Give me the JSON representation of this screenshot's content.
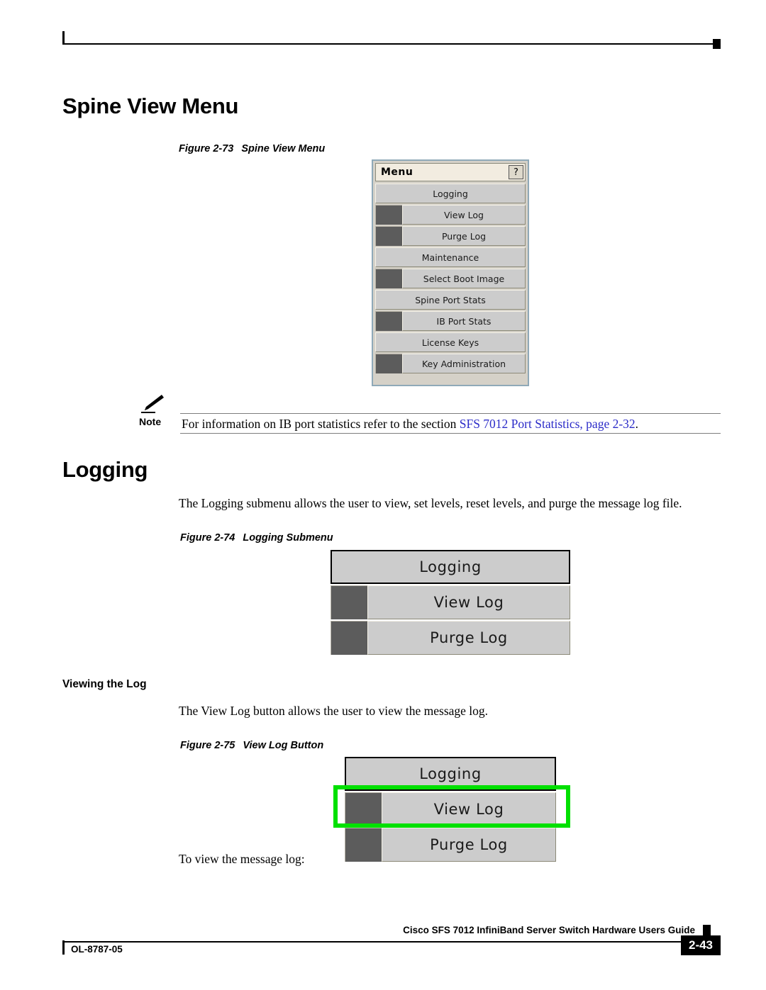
{
  "header": {
    "rule": true
  },
  "sections": {
    "spine_view_menu_heading": "Spine View Menu",
    "logging_heading": "Logging",
    "viewing_the_log_heading": "Viewing the Log"
  },
  "figures": {
    "fig_2_73": {
      "number": "Figure 2-73",
      "title": "Spine View Menu",
      "window_title": "Menu",
      "help_button": "?",
      "items": [
        {
          "label": "Logging",
          "has_swatch": false
        },
        {
          "label": "View Log",
          "has_swatch": true
        },
        {
          "label": "Purge Log",
          "has_swatch": true
        },
        {
          "label": "Maintenance",
          "has_swatch": false
        },
        {
          "label": "Select Boot Image",
          "has_swatch": true
        },
        {
          "label": "Spine Port Stats",
          "has_swatch": false
        },
        {
          "label": "IB Port Stats",
          "has_swatch": true
        },
        {
          "label": "License Keys",
          "has_swatch": false
        },
        {
          "label": "Key Administration",
          "has_swatch": true
        }
      ]
    },
    "fig_2_74": {
      "number": "Figure 2-74",
      "title": "Logging Submenu",
      "items": [
        {
          "label": "Logging",
          "has_swatch": false,
          "emphasised": true
        },
        {
          "label": "View Log",
          "has_swatch": true,
          "emphasised": false
        },
        {
          "label": "Purge Log",
          "has_swatch": true,
          "emphasised": false
        }
      ]
    },
    "fig_2_75": {
      "number": "Figure 2-75",
      "title": "View Log Button",
      "items": [
        {
          "label": "Logging",
          "has_swatch": false,
          "emphasised": true
        },
        {
          "label": "View Log",
          "has_swatch": true,
          "emphasised": false,
          "highlighted": true
        },
        {
          "label": "Purge Log",
          "has_swatch": true,
          "emphasised": false
        }
      ],
      "callout_color": "#00e000"
    }
  },
  "note": {
    "label": "Note",
    "text_before": "For information on IB port statistics refer to the section ",
    "link_text": "SFS 7012 Port Statistics, page 2-32",
    "text_after": "."
  },
  "paragraphs": {
    "logging_intro": "The Logging submenu allows the user to view, set levels, reset levels, and purge the message log file.",
    "view_log_intro": "The View Log button allows the user to view the message log.",
    "to_view": "To view the message log:"
  },
  "footer": {
    "guide_title": "Cisco SFS 7012 InfiniBand Server Switch Hardware Users Guide",
    "doc_id": "OL-8787-05",
    "page_number": "2-43"
  },
  "colors": {
    "link": "#2b2bc8",
    "callout_green": "#00e000",
    "menu_button": "#cccccc",
    "menu_swatch": "#5c5c5c",
    "menu_titlebar": "#f2ece0",
    "menu_frame": "#8fa9b8"
  }
}
